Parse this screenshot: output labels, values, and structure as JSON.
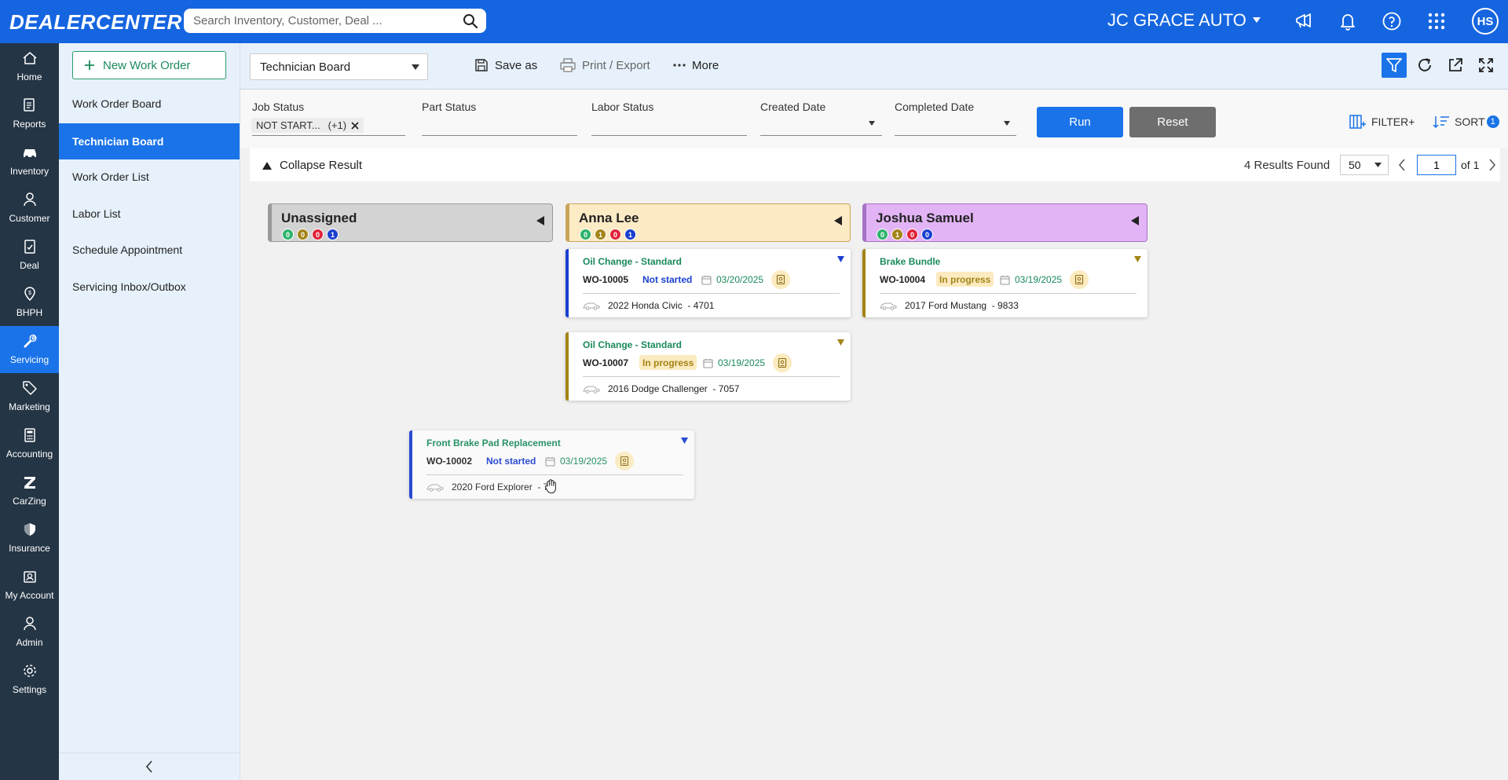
{
  "header": {
    "logo": "DEALERCENTER",
    "search_placeholder": "Search Inventory, Customer, Deal ...",
    "dealer_name": "JC GRACE AUTO",
    "avatar_initials": "HS",
    "brand_color": "#1565e0"
  },
  "rail": {
    "items": [
      {
        "label": "Home",
        "icon": "home-icon"
      },
      {
        "label": "Reports",
        "icon": "reports-icon"
      },
      {
        "label": "Inventory",
        "icon": "car-icon"
      },
      {
        "label": "Customer",
        "icon": "customer-icon"
      },
      {
        "label": "Deal",
        "icon": "deal-icon"
      },
      {
        "label": "BHPH",
        "icon": "bhph-icon"
      },
      {
        "label": "Servicing",
        "icon": "wrench-icon",
        "active": true
      },
      {
        "label": "Marketing",
        "icon": "tag-icon"
      },
      {
        "label": "Accounting",
        "icon": "calculator-icon"
      },
      {
        "label": "CarZing",
        "icon": "carzing-icon"
      },
      {
        "label": "Insurance",
        "icon": "shield-icon"
      },
      {
        "label": "My Account",
        "icon": "account-icon"
      },
      {
        "label": "Admin",
        "icon": "admin-icon"
      },
      {
        "label": "Settings",
        "icon": "gear-icon"
      }
    ]
  },
  "subnav": {
    "new_button": "New Work Order",
    "items": [
      "Work Order Board",
      "Technician Board",
      "Work Order List",
      "Labor List",
      "Schedule Appointment",
      "Servicing Inbox/Outbox"
    ],
    "active_index": 1
  },
  "toolbar": {
    "board_select": "Technician Board",
    "save_as": "Save as",
    "print_export": "Print / Export",
    "more": "More"
  },
  "filters": {
    "job_status_label": "Job Status",
    "job_status_chip": "NOT START...",
    "job_status_more": "(+1)",
    "part_status_label": "Part Status",
    "labor_status_label": "Labor Status",
    "created_date_label": "Created Date",
    "completed_date_label": "Completed Date",
    "run": "Run",
    "reset": "Reset",
    "filter_plus": "FILTER+",
    "sort": "SORT",
    "sort_count": "1"
  },
  "results": {
    "collapse_label": "Collapse Result",
    "count_text": "4 Results Found",
    "per_page": "50",
    "page": "1",
    "of_text": "of 1"
  },
  "columns": [
    {
      "name": "Unassigned",
      "bg": "#d3d3d3",
      "border": "#9a9a9a",
      "counts": [
        "0",
        "0",
        "0",
        "1"
      ]
    },
    {
      "name": "Anna Lee",
      "bg": "#fdebc6",
      "border": "#c9a45a",
      "counts": [
        "0",
        "1",
        "0",
        "1"
      ]
    },
    {
      "name": "Joshua Samuel",
      "bg": "#e2b4f5",
      "border": "#a773c4",
      "counts": [
        "0",
        "1",
        "0",
        "0"
      ]
    }
  ],
  "count_colors": [
    "#2cb36b",
    "#a38416",
    "#e0233a",
    "#1a3fcf"
  ],
  "cards": [
    {
      "title": "Oil Change - Standard",
      "wo": "WO-10005",
      "status": "Not started",
      "date": "03/20/2025",
      "vehicle": "2022 Honda Civic  - 4701"
    },
    {
      "title": "Oil Change - Standard",
      "wo": "WO-10007",
      "status": "In progress",
      "date": "03/19/2025",
      "vehicle": "2016 Dodge Challenger  - 7057"
    },
    {
      "title": "Brake Bundle",
      "wo": "WO-10004",
      "status": "In progress",
      "date": "03/19/2025",
      "vehicle": "2017 Ford Mustang  - 9833"
    },
    {
      "title": "Front Brake Pad Replacement",
      "wo": "WO-10002",
      "status": "Not started",
      "date": "03/19/2025",
      "vehicle": "2020 Ford Explorer  - 7"
    }
  ]
}
